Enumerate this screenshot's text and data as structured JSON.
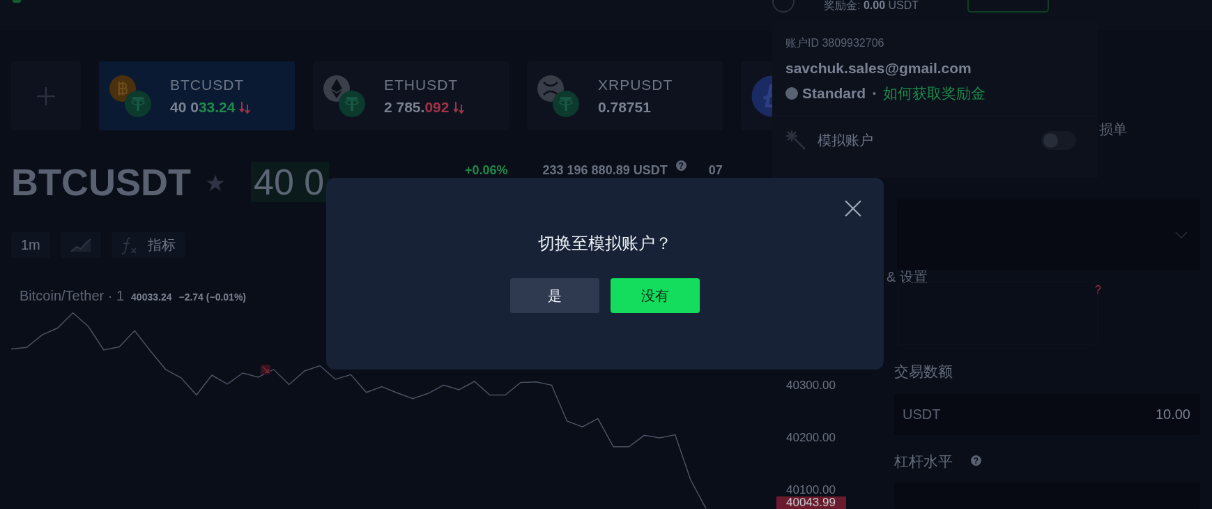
{
  "top_bar": {
    "bonus_label": "奖励金:",
    "bonus_amount": "0.00",
    "bonus_currency": "USDT"
  },
  "tickers": [
    {
      "kind": "btc",
      "symbol": "BTCUSDT",
      "price": "40 0",
      "price_tail": {
        "text": "33.24",
        "color": "#1f8a4a"
      },
      "trend_arrow": true,
      "selected": true
    },
    {
      "kind": "eth",
      "symbol": "ETHUSDT",
      "price": "2 785.",
      "price_tail": {
        "text": "092",
        "color": "#a33246"
      },
      "trend_arrow": true,
      "selected": false
    },
    {
      "kind": "xrp",
      "symbol": "XRPUSDT",
      "price": "0.78751",
      "selected": false
    },
    {
      "kind": "ltc",
      "selected": false
    }
  ],
  "instrument": {
    "symbol": "BTCUSDT",
    "price": "40 0",
    "change": "+0.06%",
    "volume": "233 196 880.89 USDT",
    "help_mark": "?",
    "column_4": "07"
  },
  "toolbar": [
    {
      "kind": "interval",
      "label": "1m"
    },
    {
      "kind": "chart-type"
    },
    {
      "kind": "indicators",
      "label": "指标"
    }
  ],
  "chart": {
    "legend": {
      "name": "Bitcoin/Tether · 1",
      "price": "40033.24",
      "change": "−2.74 (−0.01%)"
    },
    "last_price": "40043.99",
    "price_axis": [
      "40300.00",
      "40200.00",
      "40100.00"
    ]
  },
  "order_panel": {
    "tab": "损单",
    "settings_label": "& 设置",
    "warning_mark": "?",
    "amount_label": "交易数额",
    "amount_currency": "USDT",
    "amount_value": "10.00",
    "leverage_label": "杠杆水平",
    "help_mark": "?"
  },
  "account_menu": {
    "account_id": "账户ID 3809932706",
    "email": "savchuk.sales@gmail.com",
    "tier": "Standard",
    "separator": "•",
    "bonus_link": "如何获取奖励金",
    "demo_label": "模拟账户",
    "demo_on": false
  },
  "dialog": {
    "title": "切换至模拟账户？",
    "buttons": [
      {
        "kind": "secondary",
        "label": "是"
      },
      {
        "kind": "primary",
        "label": "没有"
      }
    ]
  }
}
